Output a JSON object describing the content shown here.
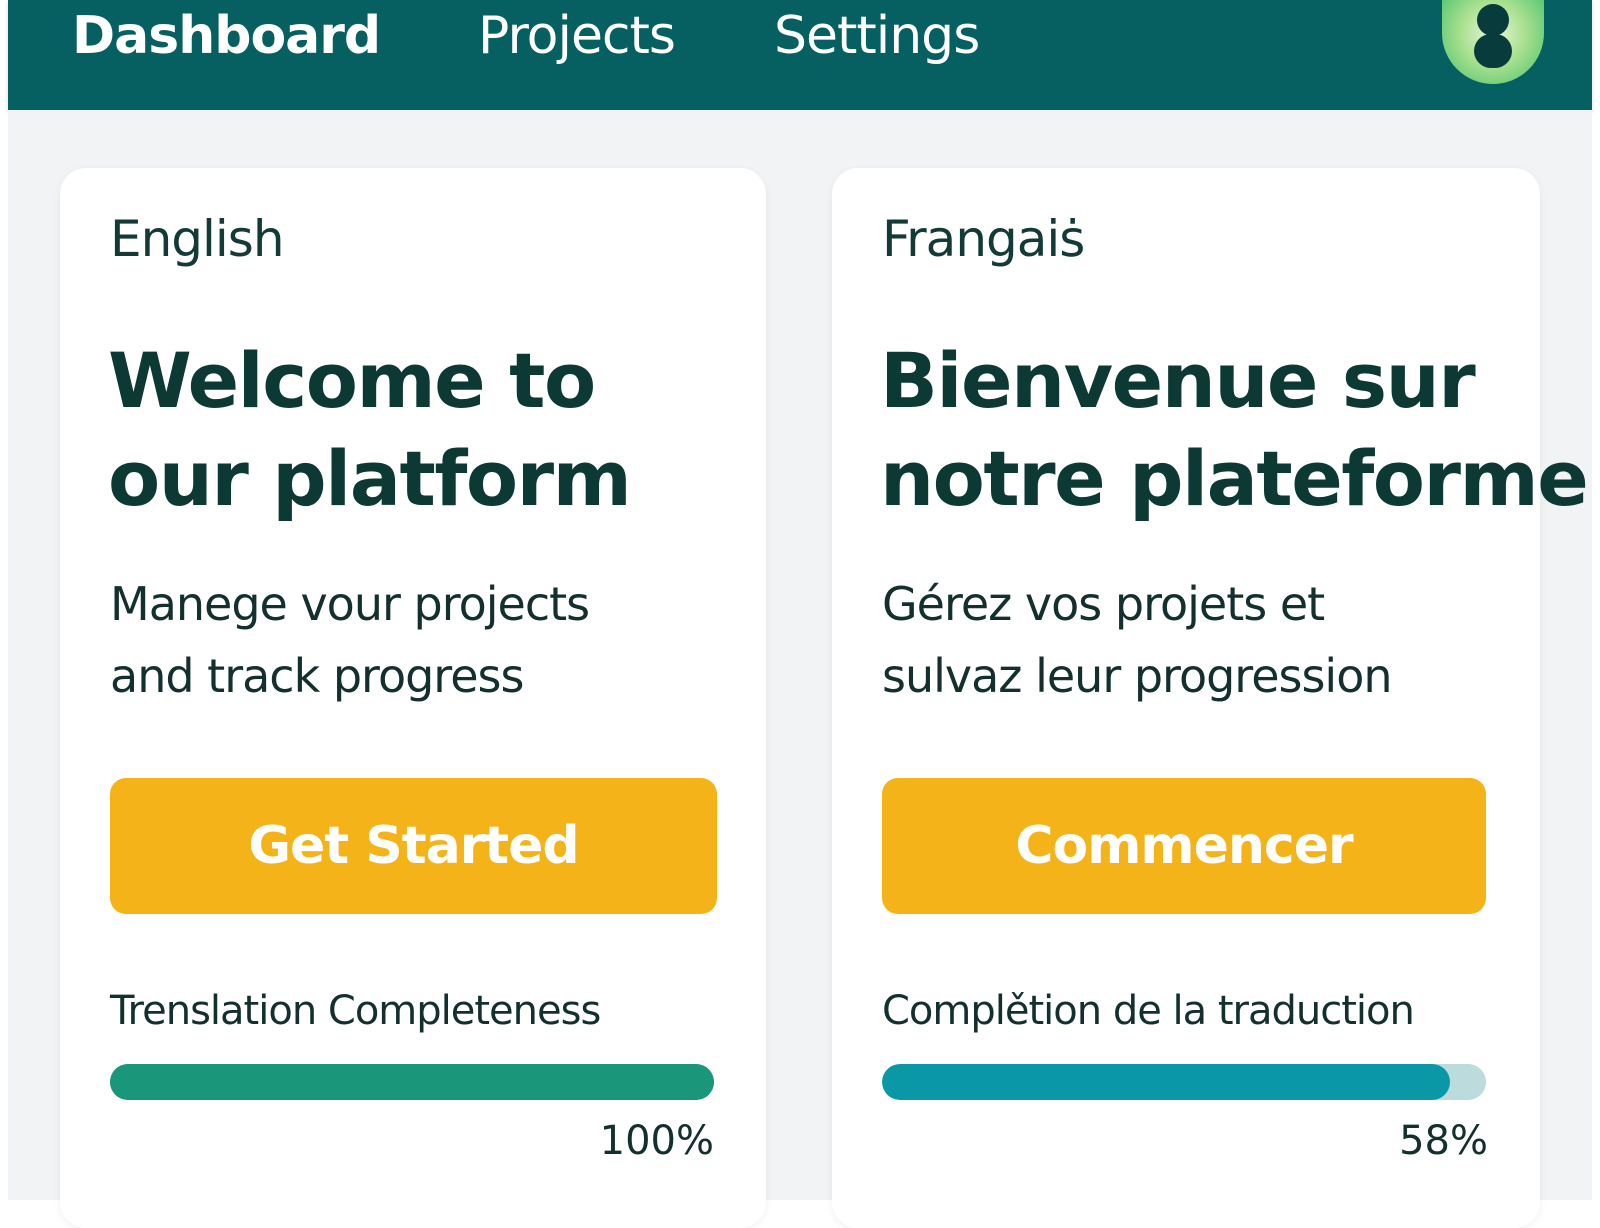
{
  "nav": {
    "items": [
      {
        "label": "Dashboard",
        "active": true
      },
      {
        "label": "Projects",
        "active": false
      },
      {
        "label": "Settings",
        "active": false
      }
    ],
    "avatar_icon": "user-avatar-icon"
  },
  "cards": {
    "english": {
      "language": "English",
      "title_line1": "Welcome to",
      "title_line2": "our platform",
      "subtitle_line1": "Manege vour projects",
      "subtitle_line2": "and track progress",
      "button_label": "Get Started",
      "progress_label": "Trenslation Completeness",
      "progress_text": "100%",
      "progress_value": 1.0,
      "progress_color": "#1a967a"
    },
    "french": {
      "language": "Frangaiṡ",
      "title_line1": "Bienvenue sur",
      "title_line2": "notre plateforme",
      "subtitle_line1": "Gérez vos projets et",
      "subtitle_line2": "sulvaz leur progression",
      "button_label": "Commencer",
      "progress_label": "Complětion de la traduction",
      "progress_text": "58%",
      "progress_value": 0.94,
      "progress_color": "#0a98a6"
    }
  },
  "colors": {
    "header_bg": "#065f60",
    "page_bg": "#f1f3f4",
    "button_bg": "#f5b31a",
    "text_dark": "#0d3935"
  }
}
